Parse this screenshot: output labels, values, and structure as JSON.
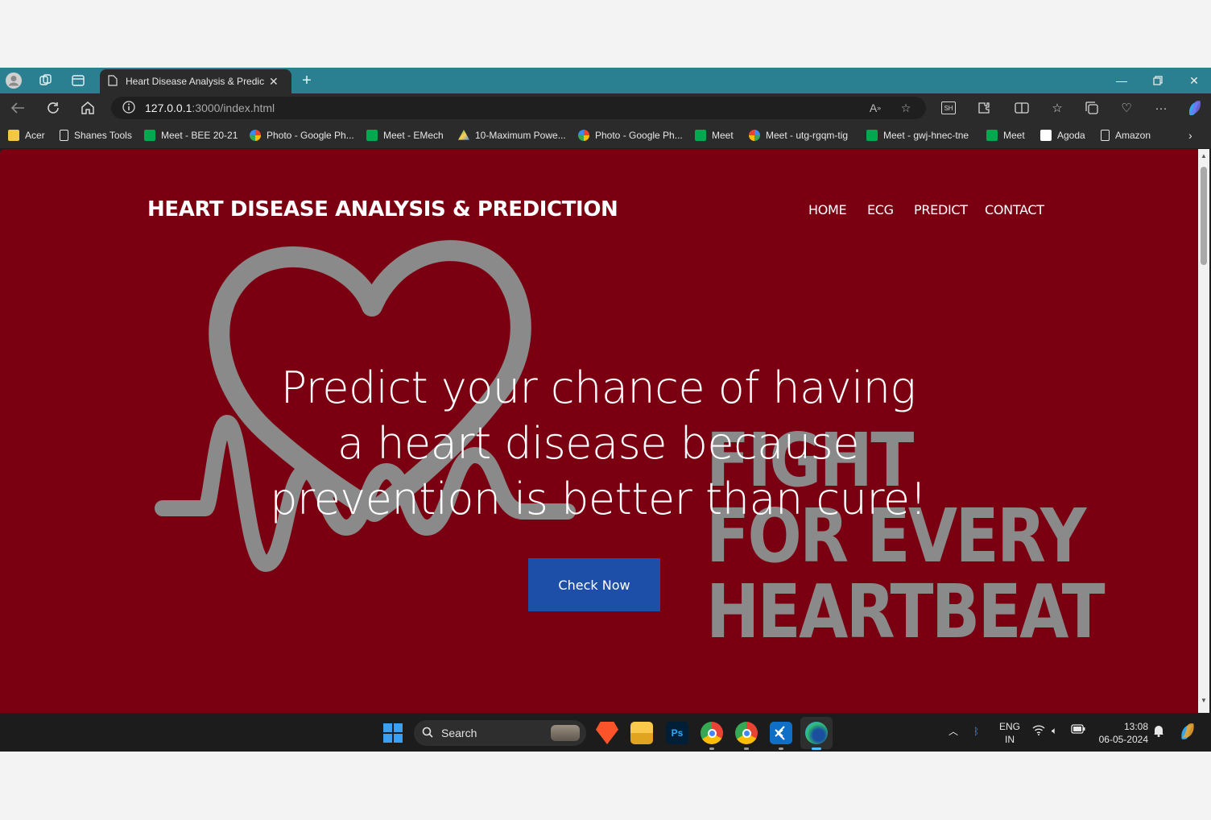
{
  "browser": {
    "tab_title": "Heart Disease Analysis & Predict",
    "url_host": "127.0.0.1",
    "url_path": ":3000/index.html",
    "window_controls": [
      "minimize",
      "restore",
      "close"
    ]
  },
  "bookmarks": [
    {
      "label": "Acer",
      "icon": "folder-icon",
      "color": "#f2c744"
    },
    {
      "label": "Shanes Tools",
      "icon": "page-icon",
      "color": "#e6e6e6"
    },
    {
      "label": "Meet - BEE 20-21",
      "icon": "meet-icon",
      "color": "#00a94f"
    },
    {
      "label": "Photo - Google Ph...",
      "icon": "photos-icon",
      "color": "#ea4335"
    },
    {
      "label": "Meet - EMech",
      "icon": "meet-icon",
      "color": "#00a94f"
    },
    {
      "label": "10-Maximum Powe...",
      "icon": "drive-icon",
      "color": "#1fa463"
    },
    {
      "label": "Photo - Google Ph...",
      "icon": "photos-icon",
      "color": "#ea4335"
    },
    {
      "label": "Meet",
      "icon": "meet-icon",
      "color": "#00a94f"
    },
    {
      "label": "Meet - utg-rgqm-tig",
      "icon": "google-icon",
      "color": "#4285f4"
    },
    {
      "label": "Meet - gwj-hnec-tne",
      "icon": "meet-icon",
      "color": "#00a94f"
    },
    {
      "label": "Meet",
      "icon": "meet-icon",
      "color": "#00a94f"
    },
    {
      "label": "Agoda",
      "icon": "agoda-icon",
      "color": "#ffffff"
    },
    {
      "label": "Amazon",
      "icon": "page-icon",
      "color": "#e6e6e6"
    }
  ],
  "page": {
    "brand": "HEART DISEASE ANALYSIS & PREDICTION",
    "nav": [
      "HOME",
      "ECG",
      "PREDICT",
      "CONTACT"
    ],
    "headline_lines": [
      "Predict your chance of having",
      "a heart disease because",
      "prevention is better than cure!"
    ],
    "cta": "Check Now",
    "slogan_lines": [
      "FIGHT",
      "FOR EVERY",
      "HEARTBEAT"
    ],
    "colors": {
      "background": "#7a0011",
      "cta": "#1e4fa8",
      "art": "#8a8a8a"
    }
  },
  "taskbar": {
    "search_placeholder": "Search",
    "apps": [
      "brave-icon",
      "file-explorer-icon",
      "photoshop-icon",
      "chrome-icon",
      "chrome-profile-icon",
      "vscode-icon",
      "edge-icon"
    ],
    "photoshop_label": "Ps",
    "language": "ENG",
    "region": "IN",
    "time": "13:08",
    "date": "06-05-2024"
  }
}
